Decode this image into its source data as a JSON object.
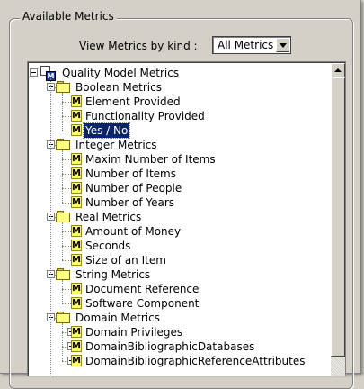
{
  "group": {
    "title": "Available Metrics"
  },
  "kind": {
    "label": "View Metrics by kind :",
    "selected": "All Metrics"
  },
  "tree": {
    "root": "Quality Model Metrics",
    "categories": [
      {
        "label": "Boolean Metrics",
        "items": [
          "Element Provided",
          "Functionality Provided",
          "Yes / No"
        ]
      },
      {
        "label": "Integer Metrics",
        "items": [
          "Maxim Number of Items",
          "Number of Items",
          "Number of People",
          "Number of Years"
        ]
      },
      {
        "label": "Real Metrics",
        "items": [
          "Amount of Money",
          "Seconds",
          "Size of an Item"
        ]
      },
      {
        "label": "String Metrics",
        "items": [
          "Document Reference",
          "Software Component"
        ]
      },
      {
        "label": "Domain Metrics",
        "items": [
          "Domain Privileges",
          "DomainBibliographicDatabases",
          "DomainBibliographicReferenceAttributes"
        ]
      }
    ],
    "selected": "Yes / No",
    "metric_icon": "M"
  },
  "icons": {
    "expander_minus": "minus-box-icon",
    "expander_plus": "plus-box-icon",
    "folder": "folder-icon",
    "metric": "metric-m-icon",
    "root": "quality-model-icon"
  }
}
